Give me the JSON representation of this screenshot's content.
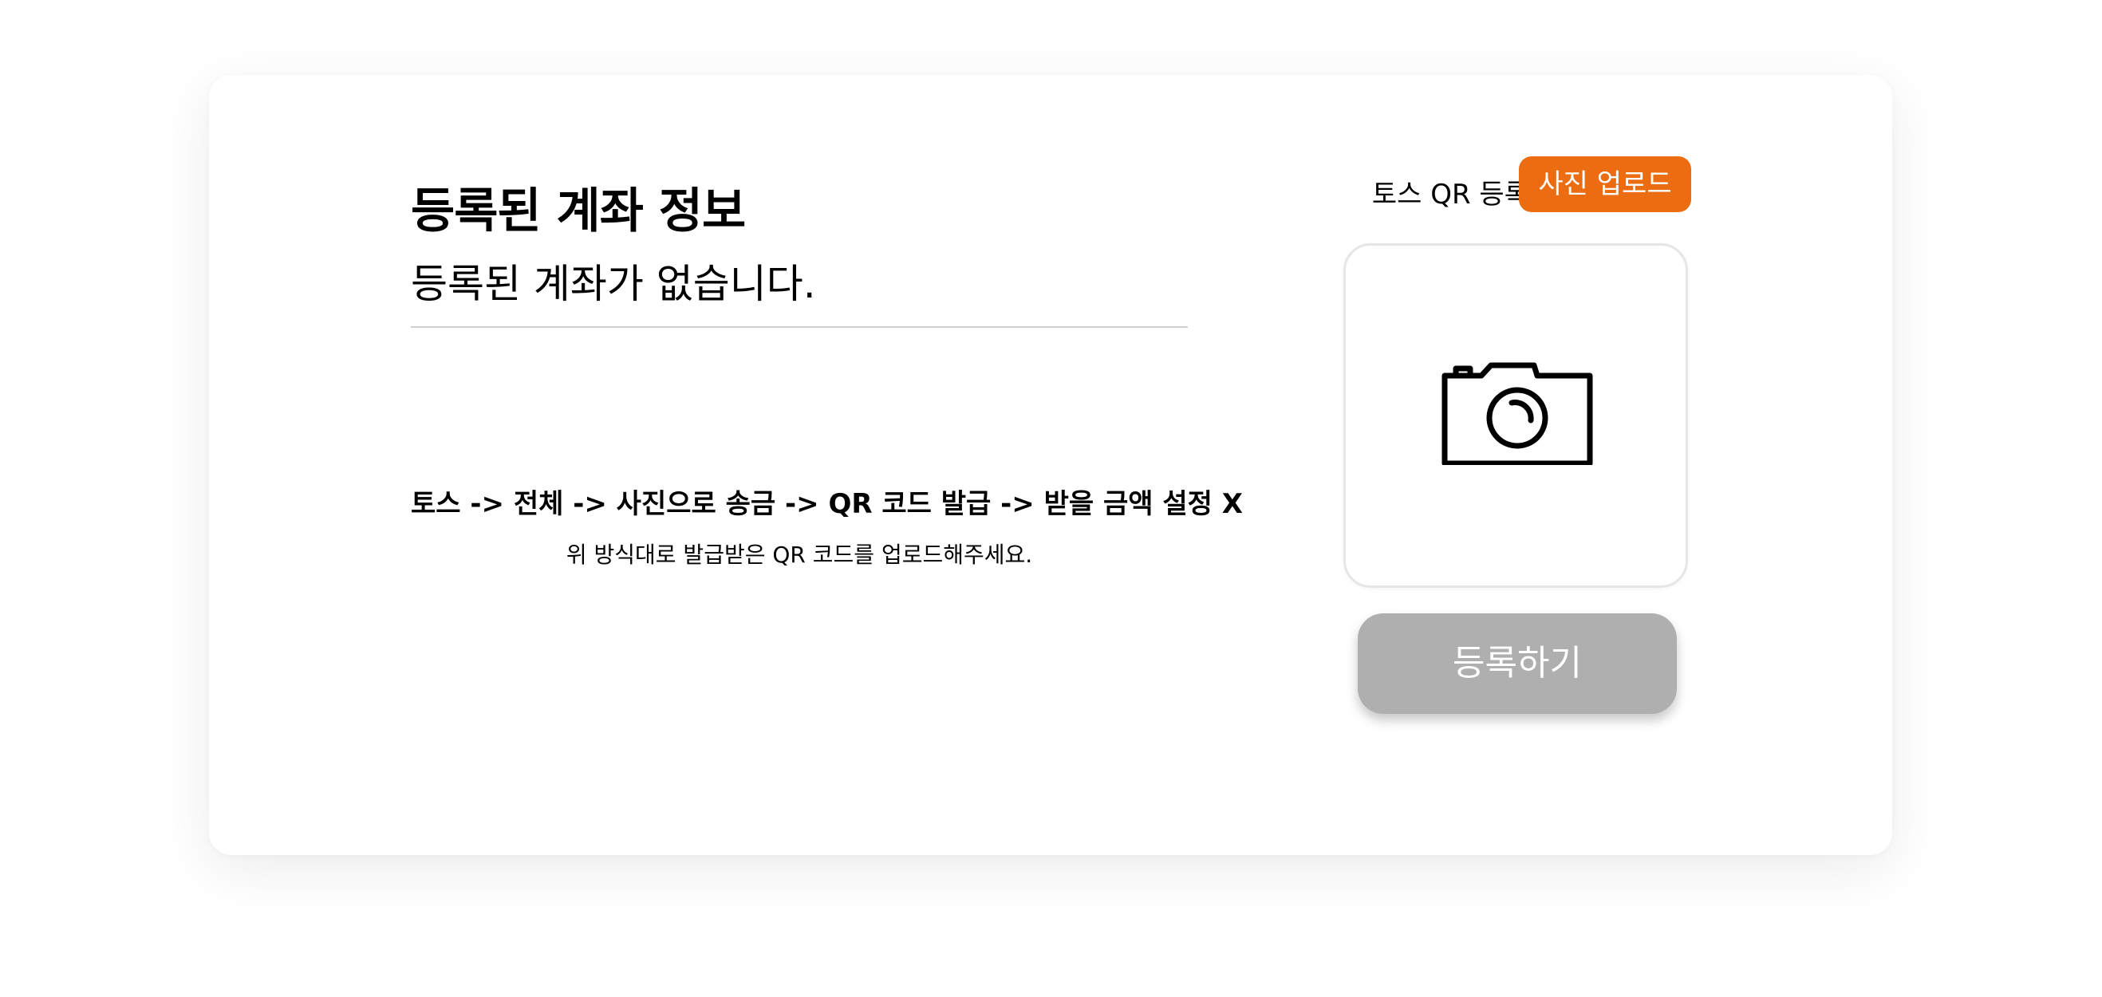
{
  "account": {
    "title": "등록된 계좌 정보",
    "empty_message": "등록된 계좌가 없습니다."
  },
  "instructions": {
    "steps": "토스 -> 전체 -> 사진으로 송금 -> QR 코드 발급 -> 받을 금액 설정 X",
    "note": "위 방식대로 발급받은 QR 코드를 업로드해주세요."
  },
  "qr_register": {
    "label": "토스 QR 등록",
    "upload_button": "사진 업로드",
    "photo_icon": "camera-icon",
    "submit_button": "등록하기"
  },
  "colors": {
    "accent": "#ec6c12",
    "disabled_button": "#afafaf",
    "divider": "#cfcfcf"
  }
}
